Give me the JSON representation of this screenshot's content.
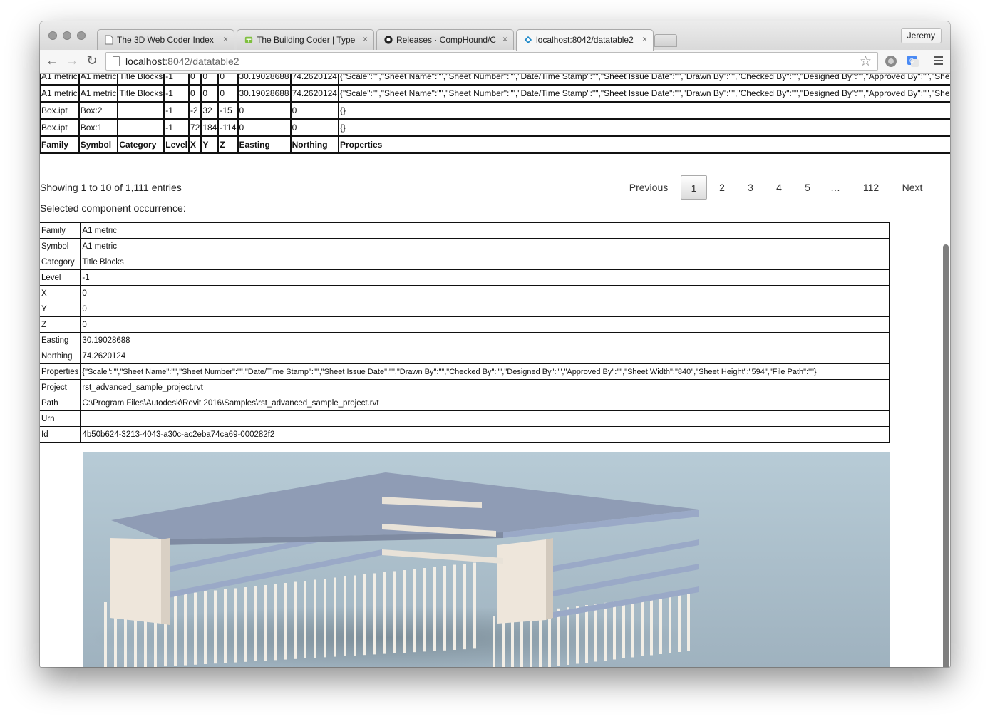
{
  "browser": {
    "tabs": [
      {
        "title": "The 3D Web Coder Index",
        "favicon": "page-icon"
      },
      {
        "title": "The Building Coder | Typepad",
        "favicon": "typepad-icon"
      },
      {
        "title": "Releases · CompHound/Co",
        "favicon": "github-icon"
      },
      {
        "title": "localhost:8042/datatable2",
        "favicon": "angular-icon"
      }
    ],
    "close_glyph": "×",
    "profile": "Jeremy",
    "url_host": "localhost",
    "url_path": ":8042/datatable2"
  },
  "grid": {
    "partial_row": [
      "A1 metric",
      "A1 metric",
      "Title Blocks",
      "-1",
      "0",
      "0",
      "0",
      "30.19028688",
      "74.2620124",
      "{\"Scale\":\"\",\"Sheet Name\":\"\",\"Sheet Number\":\"\",\"Date/Time Stamp\":\"\",\"Sheet Issue Date\":\"\",\"Drawn By\":\"\",\"Checked By\":\"\",\"Designed By\":\"\",\"Approved By\":\"\",\"Sheet"
    ],
    "rows": [
      [
        "A1 metric",
        "A1 metric",
        "Title Blocks",
        "-1",
        "0",
        "0",
        "0",
        "30.19028688",
        "74.2620124",
        "{\"Scale\":\"\",\"Sheet Name\":\"\",\"Sheet Number\":\"\",\"Date/Time Stamp\":\"\",\"Sheet Issue Date\":\"\",\"Drawn By\":\"\",\"Checked By\":\"\",\"Designed By\":\"\",\"Approved By\":\"\",\"Sheet"
      ],
      [
        "Box.ipt",
        "Box:2",
        "",
        "-1",
        "-2",
        "32",
        "-15",
        "0",
        "0",
        "{}"
      ],
      [
        "Box.ipt",
        "Box:1",
        "",
        "-1",
        "72",
        "184",
        "-114",
        "0",
        "0",
        "{}"
      ]
    ],
    "headers": [
      "Family",
      "Symbol",
      "Category",
      "Level",
      "X",
      "Y",
      "Z",
      "Easting",
      "Northing",
      "Properties"
    ]
  },
  "info_text": "Showing 1 to 10 of 1,111 entries",
  "pagination": {
    "previous": "Previous",
    "pages": [
      "1",
      "2",
      "3",
      "4",
      "5",
      "…",
      "112"
    ],
    "next": "Next",
    "current": "1"
  },
  "selected_label": "Selected component occurrence:",
  "detail": [
    {
      "key": "Family",
      "value": "A1 metric"
    },
    {
      "key": "Symbol",
      "value": "A1 metric"
    },
    {
      "key": "Category",
      "value": "Title Blocks"
    },
    {
      "key": "Level",
      "value": "-1"
    },
    {
      "key": "X",
      "value": "0"
    },
    {
      "key": "Y",
      "value": "0"
    },
    {
      "key": "Z",
      "value": "0"
    },
    {
      "key": "Easting",
      "value": "30.19028688"
    },
    {
      "key": "Northing",
      "value": "74.2620124"
    },
    {
      "key": "Properties",
      "value": "{\"Scale\":\"\",\"Sheet Name\":\"\",\"Sheet Number\":\"\",\"Date/Time Stamp\":\"\",\"Sheet Issue Date\":\"\",\"Drawn By\":\"\",\"Checked By\":\"\",\"Designed By\":\"\",\"Approved By\":\"\",\"Sheet Width\":\"840\",\"Sheet Height\":\"594\",\"File Path\":\"\"}"
    },
    {
      "key": "Project",
      "value": "rst_advanced_sample_project.rvt"
    },
    {
      "key": "Path",
      "value": "C:\\Program Files\\Autodesk\\Revit 2016\\Samples\\rst_advanced_sample_project.rvt"
    },
    {
      "key": "Urn",
      "value": ""
    },
    {
      "key": "Id",
      "value": "4b50b624-3213-4043-a30c-ac2eba74ca69-000282f2"
    }
  ],
  "colors": {
    "viewer_bg_top": "#b7cbd6",
    "viewer_bg_bottom": "#9fb2bf",
    "slab": "#9aa9c7",
    "roof": "#8f9cb5",
    "wall": "#eee6db",
    "column": "#f2eee6"
  }
}
